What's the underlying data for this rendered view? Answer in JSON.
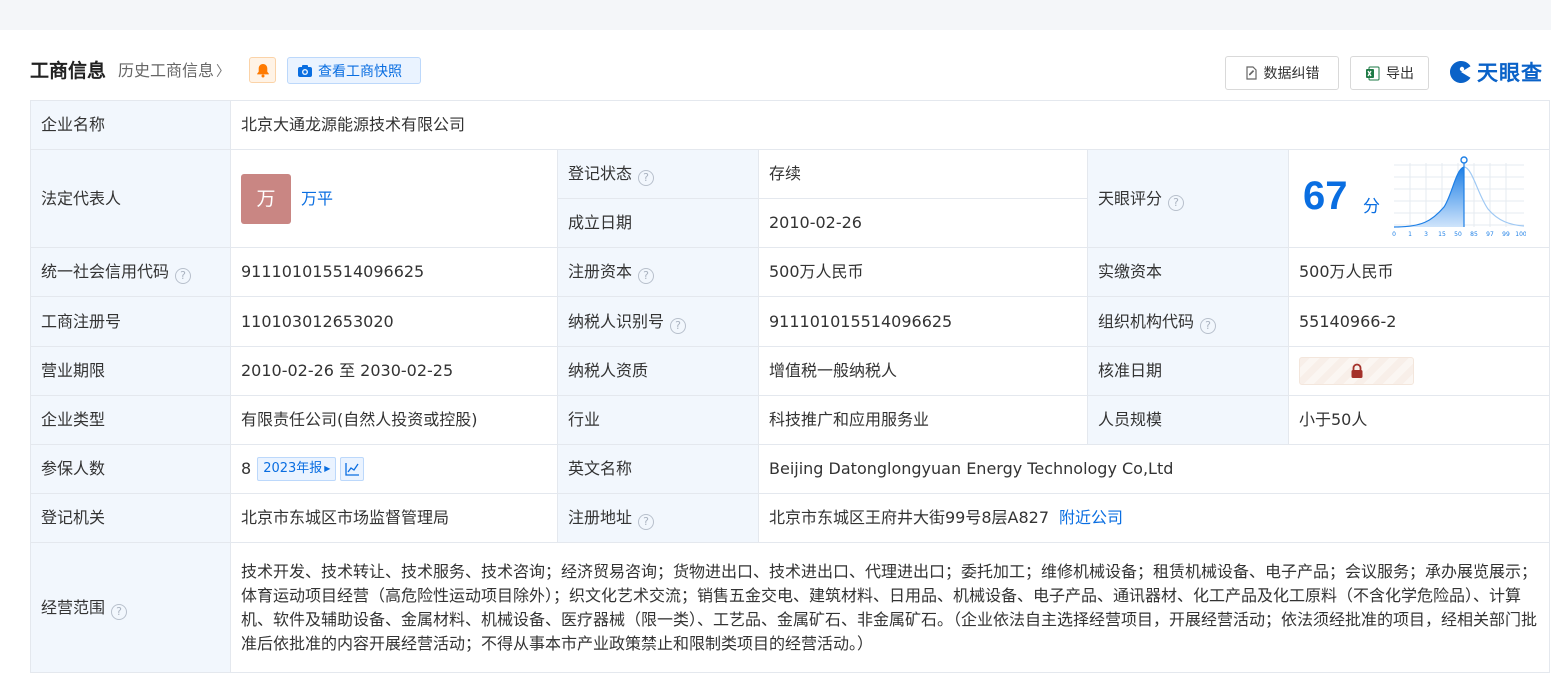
{
  "header": {
    "title": "工商信息",
    "history_link": "历史工商信息",
    "snapshot_button": "查看工商快照",
    "fix_button": "数据纠错",
    "export_button": "导出",
    "logo_text": "天眼查"
  },
  "info": {
    "company_name": {
      "label": "企业名称",
      "value": "北京大通龙源能源技术有限公司"
    },
    "legal_rep": {
      "label": "法定代表人",
      "avatar_char": "万",
      "name": "万平"
    },
    "reg_status": {
      "label": "登记状态",
      "value": "存续"
    },
    "founded": {
      "label": "成立日期",
      "value": "2010-02-26"
    },
    "tianyan_score": {
      "label": "天眼评分",
      "score": "67",
      "unit": "分",
      "axis_ticks": [
        "0",
        "1",
        "3",
        "15",
        "50",
        "85",
        "97",
        "99",
        "100"
      ]
    },
    "credit_code": {
      "label": "统一社会信用代码",
      "value": "911101015514096625"
    },
    "reg_capital": {
      "label": "注册资本",
      "value": "500万人民币"
    },
    "paid_capital": {
      "label": "实缴资本",
      "value": "500万人民币"
    },
    "reg_number": {
      "label": "工商注册号",
      "value": "110103012653020"
    },
    "taxpayer_id": {
      "label": "纳税人识别号",
      "value": "911101015514096625"
    },
    "org_code": {
      "label": "组织机构代码",
      "value": "55140966-2"
    },
    "term": {
      "label": "营业期限",
      "value": "2010-02-26 至 2030-02-25"
    },
    "taxpayer_qual": {
      "label": "纳税人资质",
      "value": "增值税一般纳税人"
    },
    "approval_date": {
      "label": "核准日期"
    },
    "company_type": {
      "label": "企业类型",
      "value": "有限责任公司(自然人投资或控股)"
    },
    "industry": {
      "label": "行业",
      "value": "科技推广和应用服务业"
    },
    "staff_size": {
      "label": "人员规模",
      "value": "小于50人"
    },
    "insured": {
      "label": "参保人数",
      "value": "8",
      "year_tag": "2023年报"
    },
    "english_name": {
      "label": "英文名称",
      "value": "Beijing Datonglongyuan Energy Technology Co,Ltd"
    },
    "reg_authority": {
      "label": "登记机关",
      "value": "北京市东城区市场监督管理局"
    },
    "reg_address": {
      "label": "注册地址",
      "value": "北京市东城区王府井大街99号8层A827",
      "nearby_link": "附近公司"
    },
    "scope": {
      "label": "经营范围",
      "value": "技术开发、技术转让、技术服务、技术咨询；经济贸易咨询；货物进出口、技术进出口、代理进出口；委托加工；维修机械设备；租赁机械设备、电子产品；会议服务；承办展览展示；体育运动项目经营（高危险性运动项目除外）；织文化艺术交流；销售五金交电、建筑材料、日用品、机械设备、电子产品、通讯器材、化工产品及化工原料（不含化学危险品）、计算机、软件及辅助设备、金属材料、机械设备、医疗器械（限一类）、工艺品、金属矿石、非金属矿石。（企业依法自主选择经营项目，开展经营活动；依法须经批准的项目，经相关部门批准后依批准的内容开展经营活动；不得从事本市产业政策禁止和限制类项目的经营活动。）"
    }
  },
  "colors": {
    "accent": "#0a6ee1",
    "status_green": "#14a35c",
    "label_bg": "#f2f7fd",
    "avatar_bg": "#c98683"
  }
}
